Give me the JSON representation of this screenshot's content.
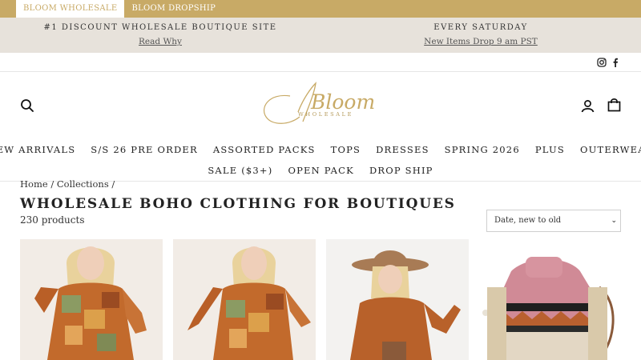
{
  "store_tabs": [
    {
      "label": "BLOOM WHOLESALE",
      "active": true
    },
    {
      "label": "BLOOM DROPSHIP",
      "active": false
    }
  ],
  "announcements": [
    {
      "headline": "#1 DISCOUNT WHOLESALE BOUTIQUE SITE",
      "link": "Read Why"
    },
    {
      "headline": "EVERY SATURDAY",
      "link": "New Items Drop 9 am PST"
    }
  ],
  "social": {
    "icons": [
      "instagram-icon",
      "facebook-icon"
    ]
  },
  "header": {
    "logo_script": "Bloom",
    "logo_sub": "WHOLESALE",
    "icons": [
      "search-icon",
      "account-icon",
      "cart-icon"
    ]
  },
  "nav": {
    "row1": [
      "NEW ARRIVALS",
      "S/S 26 PRE ORDER",
      "ASSORTED PACKS",
      "TOPS",
      "DRESSES",
      "SPRING 2026",
      "PLUS",
      "OUTERWEAR"
    ],
    "row2": [
      "SALE ($3+)",
      "OPEN PACK",
      "DROP SHIP"
    ]
  },
  "breadcrumb": {
    "home": "Home",
    "sep1": "/",
    "collections": "Collections",
    "sep2": "/"
  },
  "collection": {
    "title": "WHOLESALE BOHO CLOTHING FOR BOUTIQUES",
    "count": "230 products"
  },
  "sort": {
    "selected": "Date, new to old"
  },
  "colors": {
    "gold": "#c8aa66",
    "announce_bg": "#e7e2db"
  }
}
